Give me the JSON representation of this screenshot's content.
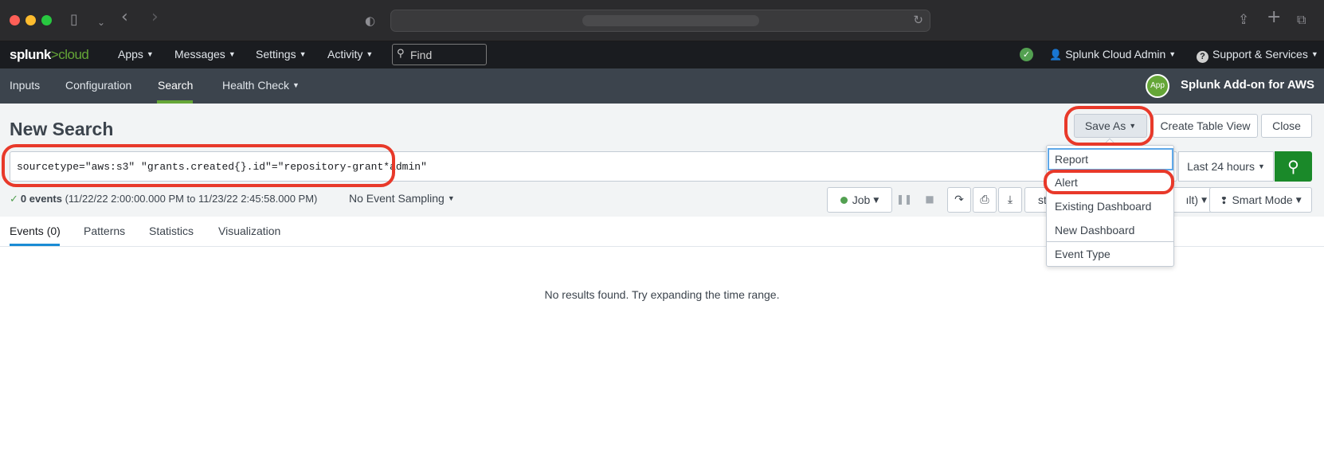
{
  "browser": {},
  "topnav": {
    "logo_main": "splunk",
    "logo_accent": ">cloud",
    "apps": "Apps",
    "messages": "Messages",
    "settings": "Settings",
    "activity": "Activity",
    "find_placeholder": "Find",
    "user": "Splunk Cloud Admin",
    "support": "Support & Services"
  },
  "appbar": {
    "nav": [
      "Inputs",
      "Configuration",
      "Search",
      "Health Check"
    ],
    "active": "Search",
    "badge": "App",
    "app_title": "Splunk Add-on for AWS"
  },
  "search": {
    "title": "New Search",
    "save_as": "Save As",
    "create_table_view": "Create Table View",
    "close": "Close",
    "query": "sourcetype=\"aws:s3\" \"grants.created{}.id\"=\"repository-grant*admin\"",
    "time_range": "Last 24 hours"
  },
  "status": {
    "events": "0 events",
    "range": "(11/22/22 2:00:00.000 PM to 11/23/22 2:45:58.000 PM)",
    "sampling": "No Event Sampling",
    "job": "Job",
    "partial_left": "st",
    "partial_right": "ılt)",
    "mode": "Smart Mode"
  },
  "tabs": [
    "Events (0)",
    "Patterns",
    "Statistics",
    "Visualization"
  ],
  "results": {
    "empty_message": "No results found. Try expanding the time range."
  },
  "save_as_menu": {
    "items": [
      "Report",
      "Alert",
      "Existing Dashboard",
      "New Dashboard",
      "Event Type"
    ]
  },
  "colors": {
    "splunk_green": "#65a637",
    "annotation_red": "#e8392a",
    "search_green": "#1a8929",
    "tab_blue": "#1a8bd4"
  }
}
